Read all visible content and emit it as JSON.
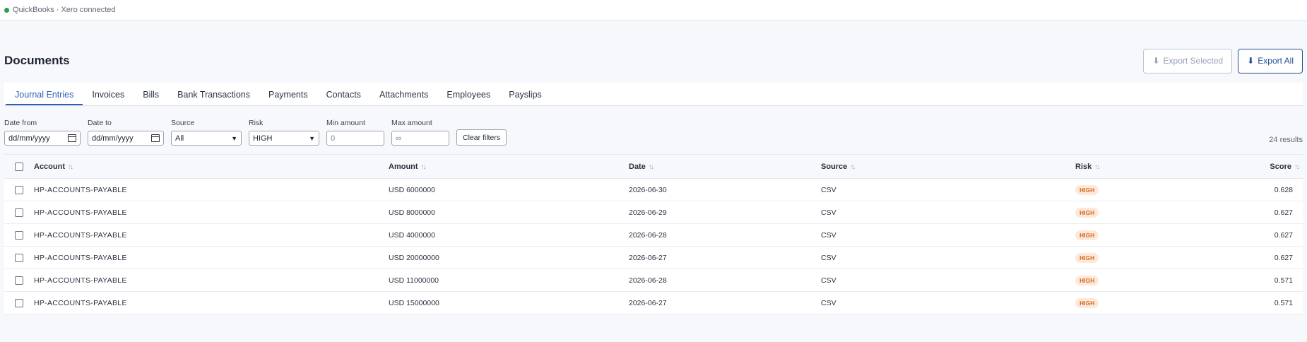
{
  "status": {
    "text": "QuickBooks · Xero connected",
    "color": "#22a447"
  },
  "page": {
    "title": "Documents"
  },
  "actions": {
    "export_selected": "Export Selected",
    "export_all": "Export All",
    "icon": "download-arrow-icon"
  },
  "tabs": [
    {
      "label": "Journal Entries",
      "active": true
    },
    {
      "label": "Invoices"
    },
    {
      "label": "Bills"
    },
    {
      "label": "Bank Transactions"
    },
    {
      "label": "Payments"
    },
    {
      "label": "Contacts"
    },
    {
      "label": "Attachments"
    },
    {
      "label": "Employees"
    },
    {
      "label": "Payslips"
    }
  ],
  "filters": {
    "date_from": {
      "label": "Date from",
      "placeholder": "dd/mm/yyyy"
    },
    "date_to": {
      "label": "Date to",
      "placeholder": "dd/mm/yyyy"
    },
    "source": {
      "label": "Source",
      "value": "All"
    },
    "risk": {
      "label": "Risk",
      "value": "HIGH"
    },
    "min_amount": {
      "label": "Min amount",
      "placeholder": "0"
    },
    "max_amount": {
      "label": "Max amount",
      "placeholder": "∞"
    },
    "clear": "Clear filters",
    "results": "24 results"
  },
  "table": {
    "headers": {
      "account": "Account",
      "amount": "Amount",
      "date": "Date",
      "source": "Source",
      "risk": "Risk",
      "score": "Score"
    },
    "rows": [
      {
        "account": "HP-ACCOUNTS-PAYABLE",
        "amount": "USD 6000000",
        "date": "2026-06-30",
        "source": "CSV",
        "risk": "HIGH",
        "score": "0.628"
      },
      {
        "account": "HP-ACCOUNTS-PAYABLE",
        "amount": "USD 8000000",
        "date": "2026-06-29",
        "source": "CSV",
        "risk": "HIGH",
        "score": "0.627"
      },
      {
        "account": "HP-ACCOUNTS-PAYABLE",
        "amount": "USD 4000000",
        "date": "2026-06-28",
        "source": "CSV",
        "risk": "HIGH",
        "score": "0.627"
      },
      {
        "account": "HP-ACCOUNTS-PAYABLE",
        "amount": "USD 20000000",
        "date": "2026-06-27",
        "source": "CSV",
        "risk": "HIGH",
        "score": "0.627"
      },
      {
        "account": "HP-ACCOUNTS-PAYABLE",
        "amount": "USD 11000000",
        "date": "2026-06-28",
        "source": "CSV",
        "risk": "HIGH",
        "score": "0.571"
      },
      {
        "account": "HP-ACCOUNTS-PAYABLE",
        "amount": "USD 15000000",
        "date": "2026-06-27",
        "source": "CSV",
        "risk": "HIGH",
        "score": "0.571"
      }
    ]
  }
}
